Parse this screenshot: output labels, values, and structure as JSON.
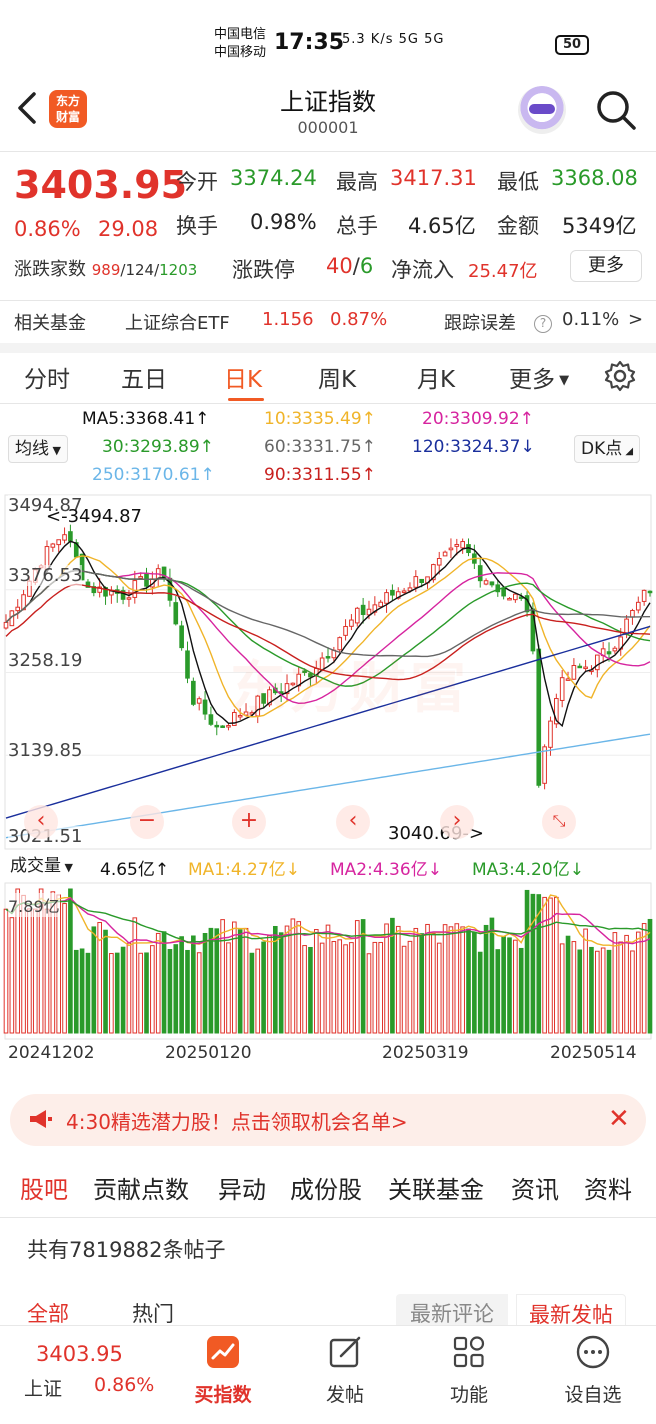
{
  "status_bar": {
    "carrier1": "中国电信",
    "carrier2": "中国移动",
    "time": "17:35",
    "icons": "5.3 K/s  5G  5G",
    "battery": "50"
  },
  "header": {
    "logo_text_1": "东方",
    "logo_text_2": "财富",
    "title": "上证指数",
    "code": "000001"
  },
  "quote": {
    "price": "3403.95",
    "change_pct": "0.86%",
    "change": "29.08",
    "open_label": "今开",
    "open": "3374.24",
    "high_label": "最高",
    "high": "3417.31",
    "low_label": "最低",
    "low": "3368.08",
    "turnover_label": "换手",
    "turnover": "0.98%",
    "volume_label": "总手",
    "volume": "4.65亿",
    "amount_label": "金额",
    "amount": "5349亿",
    "adv_label": "涨跌家数",
    "adv_up": "989",
    "adv_flat": "124",
    "adv_down": "1203",
    "limit_label": "涨跌停",
    "limit_up": "40",
    "limit_down": "6",
    "net_label": "净流入",
    "net": "25.47亿",
    "more": "更多"
  },
  "fund": {
    "label": "相关基金",
    "name": "上证综合ETF",
    "price": "1.156",
    "pct": "0.87%",
    "error_label": "跟踪误差",
    "error": "0.11%",
    "arrow": ">"
  },
  "tabs": [
    "分时",
    "五日",
    "日K",
    "周K",
    "月K",
    "更多"
  ],
  "active_tab": "日K",
  "ma_legend": {
    "selector": "均线",
    "dk": "DK点",
    "ma5": "MA5:3368.41↑",
    "ma10": "10:3335.49↑",
    "ma20": "20:3309.92↑",
    "ma30": "30:3293.89↑",
    "ma60": "60:3331.75↑",
    "ma120": "120:3324.37↓",
    "ma250": "250:3170.61↑",
    "ma90": "90:3311.55↑"
  },
  "chart": {
    "y_labels": [
      "3494.87",
      "3376.53",
      "3258.19",
      "3139.85",
      "3021.51"
    ],
    "high_marker": "<-3494.87",
    "low_marker": "3040.69->",
    "watermark": "东方财富"
  },
  "volume": {
    "selector": "成交量",
    "value": "4.65亿↑",
    "ma1": "MA1:4.27亿↓",
    "ma2": "MA2:4.36亿↓",
    "ma3": "MA3:4.20亿↓",
    "max_label": "7.89亿",
    "dates": [
      "20241202",
      "20250120",
      "20250319",
      "20250514"
    ]
  },
  "colors": {
    "up": "#e0332b",
    "down": "#2a9a2a",
    "brand": "#f15a24",
    "ma5": "#111111",
    "ma10": "#f0b429",
    "ma20": "#d6249f",
    "ma30": "#2a9a2a",
    "ma60": "#666666",
    "ma120": "#1a2f9c",
    "ma250": "#6bb6e8",
    "ma90": "#c8201e"
  },
  "banner": {
    "text": "4:30精选潜力股！点击领取机会名单>"
  },
  "sub_tabs": [
    "股吧",
    "贡献点数",
    "异动",
    "成份股",
    "关联基金",
    "资讯",
    "资料"
  ],
  "posts_count": "共有7819882条帖子",
  "filters": {
    "all": "全部",
    "hot": "热门",
    "latest_comment": "最新评论",
    "latest_post": "最新发帖"
  },
  "bottom_nav": {
    "price": "3403.95",
    "name": "上证",
    "pct": "0.86%",
    "buy": "买指数",
    "post": "发帖",
    "func": "功能",
    "watch": "设自选"
  }
}
